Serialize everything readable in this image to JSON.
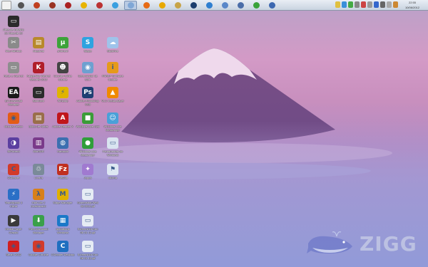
{
  "taskbar": {
    "buttons": [
      {
        "name": "app-icon-1",
        "color": "#555555"
      },
      {
        "name": "gamecube-icon",
        "color": "#c04020"
      },
      {
        "name": "game-icon-1",
        "color": "#993322"
      },
      {
        "name": "assassin-icon",
        "color": "#aa2222"
      },
      {
        "name": "ubisoft-icon",
        "color": "#e8b400"
      },
      {
        "name": "game-icon-2",
        "color": "#b33"
      },
      {
        "name": "messenger-icon",
        "color": "#3aa0e0"
      },
      {
        "name": "window-icon",
        "color": "#7fa7d6",
        "active": true
      },
      {
        "name": "firefox-icon",
        "color": "#e76b15"
      },
      {
        "name": "winamp-icon",
        "color": "#e8a900"
      },
      {
        "name": "folder-icon",
        "color": "#c7a447"
      },
      {
        "name": "photoshop-icon",
        "color": "#1c3d6e"
      },
      {
        "name": "browser-icon",
        "color": "#2f7fd0"
      },
      {
        "name": "network-icon",
        "color": "#5a87c9"
      },
      {
        "name": "monitor-icon",
        "color": "#4a6da8"
      },
      {
        "name": "utorrent-icon",
        "color": "#3aa33a"
      },
      {
        "name": "window-icon-2",
        "color": "#3c67b0"
      }
    ],
    "tray": [
      "#e0c040",
      "#3a8fd9",
      "#44aa44",
      "#888888",
      "#cc4444",
      "#999999",
      "#3366cc",
      "#666666",
      "#aaaaaa",
      "#cc8833"
    ],
    "clock": {
      "time": "22:55",
      "date": "10/06/2012"
    }
  },
  "icons": [
    {
      "name": "logmein-icon",
      "label": "Área de trabalho 22 Área de 22 Google",
      "glyph": "▭",
      "bg": "#2b2b2b",
      "col": 0,
      "row": 0
    },
    {
      "name": "tools-icon",
      "label": "Meu Nimbus",
      "glyph": "✂",
      "bg": "#8a8a8a",
      "col": 0,
      "row": 1
    },
    {
      "name": "archive-icon",
      "label": "Arquivos",
      "glyph": "▤",
      "bg": "#b8892b",
      "col": 1,
      "row": 1
    },
    {
      "name": "utorrent-icon",
      "label": "µTorrent",
      "glyph": "µ",
      "bg": "#3da33a",
      "col": 2,
      "row": 1
    },
    {
      "name": "skype-icon",
      "label": "Skype",
      "glyph": "S",
      "bg": "#2ea3e0",
      "col": 3,
      "row": 1
    },
    {
      "name": "skydrive-icon",
      "label": "SkyDrive",
      "glyph": "☁",
      "bg": "#9fc3ea",
      "col": 4,
      "row": 1
    },
    {
      "name": "computer-icon",
      "label": "Rede e Internet",
      "glyph": "▭",
      "bg": "#8e8e8e",
      "col": 0,
      "row": 2
    },
    {
      "name": "kaspersky-icon",
      "label": "Kaspersky Internet Security 2012",
      "glyph": "K",
      "bg": "#b01e2a",
      "col": 1,
      "row": 2
    },
    {
      "name": "counterstrike-icon",
      "label": "Counter-Strike Source",
      "glyph": "☻",
      "bg": "#444444",
      "col": 2,
      "row": 2
    },
    {
      "name": "webcam-icon",
      "label": "Gerenciador de Som",
      "glyph": "◉",
      "bg": "#6ea0d0",
      "col": 3,
      "row": 2
    },
    {
      "name": "info-icon",
      "label": "PAREP Software Update",
      "glyph": "i",
      "bg": "#e59a1a",
      "col": 4,
      "row": 2
    },
    {
      "name": "ea-icon",
      "label": "EA Download Manager",
      "glyph": "EA",
      "bg": "#1a1a1a",
      "col": 0,
      "row": 3
    },
    {
      "name": "steam-icon",
      "label": "Bambam",
      "glyph": "▭",
      "bg": "#2c2c2c",
      "col": 1,
      "row": 3
    },
    {
      "name": "winamp-icon",
      "label": "Winamp",
      "glyph": "⚡",
      "bg": "#e0b400",
      "col": 2,
      "row": 3
    },
    {
      "name": "photoshop-icon",
      "label": "Adobe Photoshop CS5",
      "glyph": "Ps",
      "bg": "#1e3f73",
      "col": 3,
      "row": 3
    },
    {
      "name": "vlc-icon",
      "label": "VLC media player",
      "glyph": "▲",
      "bg": "#f08a00",
      "col": 4,
      "row": 3
    },
    {
      "name": "firefox-icon",
      "label": "Mozilla Firefox",
      "glyph": "◉",
      "bg": "#e35c16",
      "col": 0,
      "row": 4
    },
    {
      "name": "notepad-icon",
      "label": "Bloco de Notas",
      "glyph": "▤",
      "bg": "#9a6e4a",
      "col": 1,
      "row": 4
    },
    {
      "name": "acrobat-icon",
      "label": "Adobe Reader X",
      "glyph": "A",
      "bg": "#c0161b",
      "col": 2,
      "row": 4
    },
    {
      "name": "xbox-icon",
      "label": "Windows Live Mail",
      "glyph": "■",
      "bg": "#3b9c38",
      "col": 3,
      "row": 4
    },
    {
      "name": "messenger-icon",
      "label": "Windows Live Messenger",
      "glyph": "☺",
      "bg": "#4aa0d8",
      "col": 4,
      "row": 4
    },
    {
      "name": "bittorrent-icon",
      "label": "BitTorrent",
      "glyph": "◑",
      "bg": "#5b3fa0",
      "col": 0,
      "row": 5
    },
    {
      "name": "winrar-icon",
      "label": "WinRAR",
      "glyph": "▥",
      "bg": "#7a3a8a",
      "col": 1,
      "row": 5
    },
    {
      "name": "hamachi-icon",
      "label": "Hamachi",
      "glyph": "◍",
      "bg": "#3c6fb0",
      "col": 2,
      "row": 5
    },
    {
      "name": "live-icon",
      "label": "Windows Live Messenger",
      "glyph": "●",
      "bg": "#2f9e3a",
      "col": 3,
      "row": 5
    },
    {
      "name": "window-icon",
      "label": "Ferramentas do Windows",
      "glyph": "▭",
      "bg": "#d9e4f0",
      "col": 4,
      "row": 5
    },
    {
      "name": "ccleaner-icon",
      "label": "CCleaner",
      "glyph": "C",
      "bg": "#d23a2a",
      "col": 0,
      "row": 6
    },
    {
      "name": "trash-icon",
      "label": "Lixeira",
      "glyph": "♲",
      "bg": "#7a8a99",
      "col": 1,
      "row": 6
    },
    {
      "name": "filezilla-icon",
      "label": "FileZilla",
      "glyph": "Fz",
      "bg": "#c03020",
      "col": 2,
      "row": 6
    },
    {
      "name": "sparkle-icon",
      "label": "Jogos",
      "glyph": "✦",
      "bg": "#a07ad0",
      "col": 3,
      "row": 6
    },
    {
      "name": "flag-icon",
      "label": "Idioma",
      "glyph": "⚑",
      "bg": "#dde6f2",
      "col": 4,
      "row": 6
    },
    {
      "name": "teamspeak-icon",
      "label": "TeamSpeak 3 Client",
      "glyph": "⚡",
      "bg": "#2a6fc6",
      "col": 0,
      "row": 7
    },
    {
      "name": "halflife-icon",
      "label": "Half-Life 2 Deathmatch",
      "glyph": "λ",
      "bg": "#d8801a",
      "col": 1,
      "row": 7
    },
    {
      "name": "mame-icon",
      "label": "Mage Manager",
      "glyph": "M",
      "bg": "#e0b000",
      "col": 2,
      "row": 7
    },
    {
      "name": "screenshot-icon",
      "label": "Screenshot-Wed 06 2012.gif",
      "glyph": "▭",
      "bg": "#e6ecf4",
      "col": 3,
      "row": 7
    },
    {
      "name": "media-player-icon",
      "label": "Media Player Classic",
      "glyph": "▶",
      "bg": "#3a3a3a",
      "col": 0,
      "row": 8
    },
    {
      "name": "download-icon",
      "label": "Free Download Manager",
      "glyph": "⬇",
      "bg": "#3aa04a",
      "col": 1,
      "row": 8
    },
    {
      "name": "apps-icon",
      "label": "Aplicativos Windows",
      "glyph": "▦",
      "bg": "#1a78c8",
      "col": 2,
      "row": 8
    },
    {
      "name": "screenshot-icon-2",
      "label": "Screenshot-Sun 06 21 12.gif",
      "glyph": "▭",
      "bg": "#e6ecf4",
      "col": 3,
      "row": 8
    },
    {
      "name": "shortcut-icon",
      "label": "Steam 2012",
      "glyph": "◈",
      "bg": "#d02020",
      "col": 0,
      "row": 9
    },
    {
      "name": "chrome-icon",
      "label": "Google Chrome",
      "glyph": "◉",
      "bg": "#d33b2b",
      "col": 1,
      "row": 9
    },
    {
      "name": "ccleaner-icon-2",
      "label": "CCleaner Desktop",
      "glyph": "C",
      "bg": "#1f6fc0",
      "col": 2,
      "row": 9
    },
    {
      "name": "screenshot-icon-3",
      "label": "Screenshot-Sun 06 21 12.gif",
      "glyph": "▭",
      "bg": "#e6ecf4",
      "col": 3,
      "row": 9
    }
  ],
  "watermark": {
    "text": "ZIGG"
  }
}
